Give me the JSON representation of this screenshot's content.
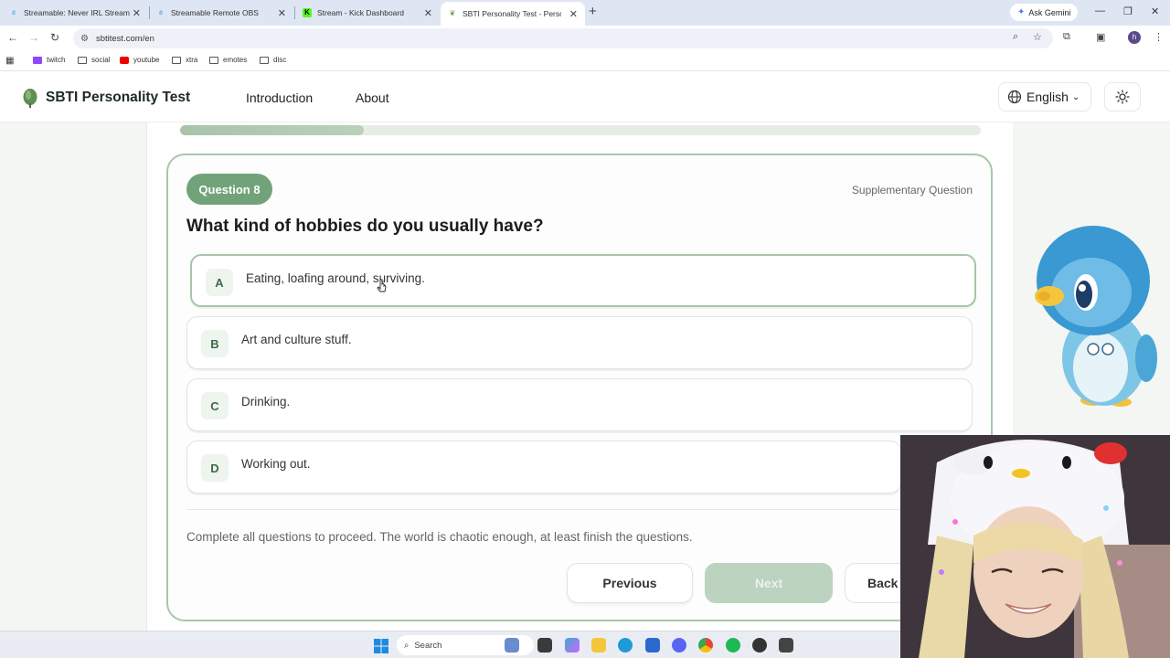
{
  "browser": {
    "tabs": [
      {
        "title": "Streamable: Never IRL Stream W",
        "active": false
      },
      {
        "title": "Streamable Remote OBS",
        "active": false
      },
      {
        "title": "Stream - Kick Dashboard",
        "active": false
      },
      {
        "title": "SBTI Personality Test - Personali",
        "active": true
      }
    ],
    "ask_gemini": "Ask Gemini",
    "url": "sbtitest.com/en",
    "profile_initial": "h",
    "bookmarks": [
      "twitch",
      "social",
      "youtube",
      "xtra",
      "emotes",
      "disc"
    ]
  },
  "site": {
    "brand": "SBTI Personality Test",
    "nav": {
      "introduction": "Introduction",
      "about": "About"
    },
    "language": "English"
  },
  "quiz": {
    "progress": 0.23,
    "question_badge": "Question 8",
    "question_type": "Supplementary Question",
    "question_text": "What kind of hobbies do you usually have?",
    "options": [
      {
        "letter": "A",
        "text": "Eating, loafing around, surviving."
      },
      {
        "letter": "B",
        "text": "Art and culture stuff."
      },
      {
        "letter": "C",
        "text": "Drinking."
      },
      {
        "letter": "D",
        "text": "Working out."
      }
    ],
    "hint": "Complete all questions to proceed. The world is chaotic enough, at least finish the questions.",
    "buttons": {
      "previous": "Previous",
      "next": "Next",
      "back": "Back t"
    }
  },
  "taskbar": {
    "search_placeholder": "Search"
  },
  "colors": {
    "accent": "#72a27a",
    "accent_light": "#a9c6ac",
    "next_disabled": "#bcd3bf"
  }
}
